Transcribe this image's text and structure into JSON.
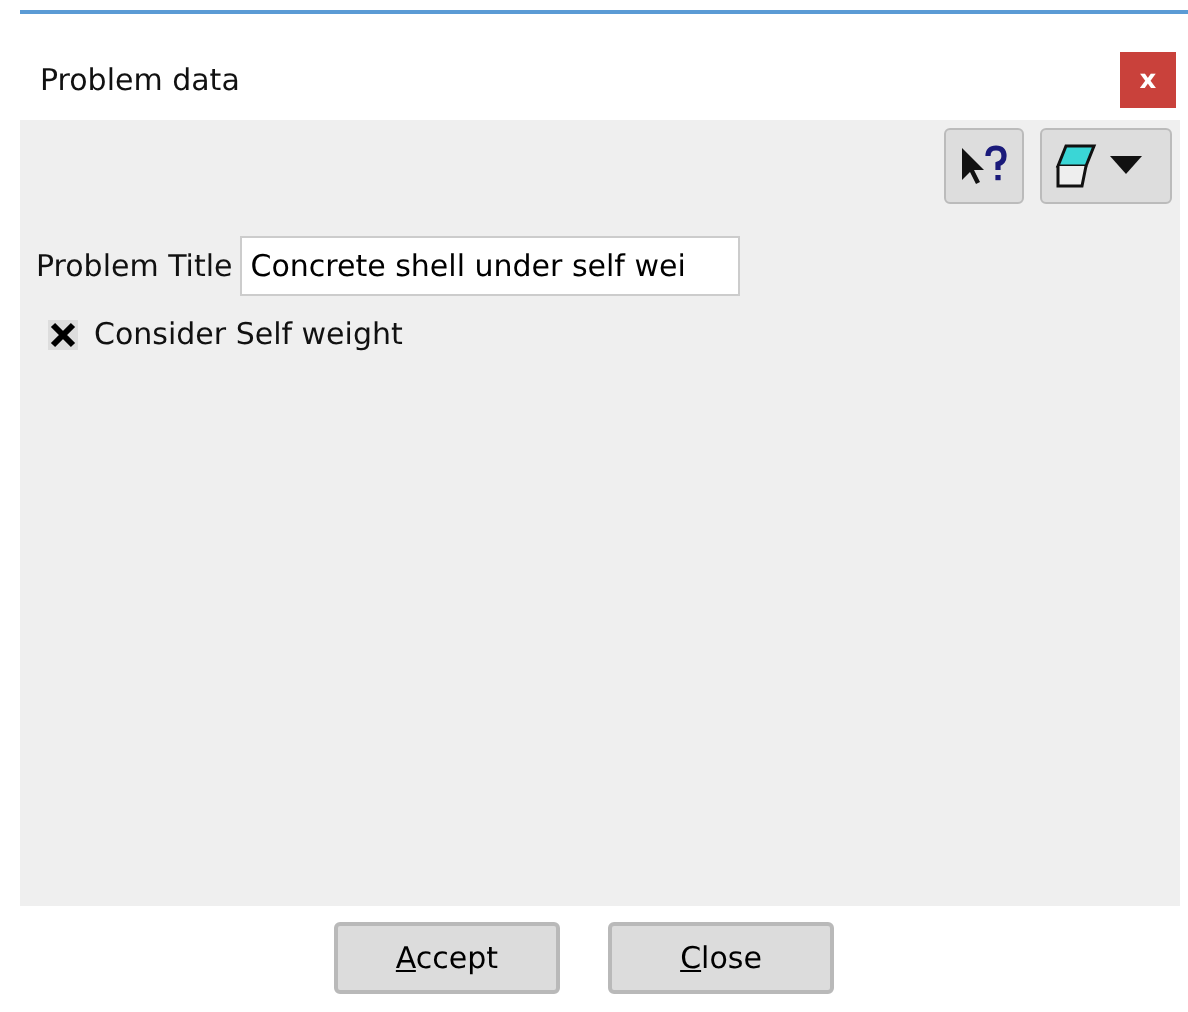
{
  "window": {
    "title": "Problem data",
    "close_glyph": "x"
  },
  "toolbar": {
    "buttons": [
      {
        "kind": "help"
      },
      {
        "kind": "dropdown"
      }
    ]
  },
  "problem_title": {
    "label": "Problem Title",
    "value": "Concrete shell under self wei"
  },
  "options": [
    {
      "label": "Consider Self weight",
      "checked": true
    }
  ],
  "buttons": [
    {
      "label": "Accept",
      "first_letter_underlined": true
    },
    {
      "label": "Close",
      "first_letter_underlined": true
    }
  ]
}
